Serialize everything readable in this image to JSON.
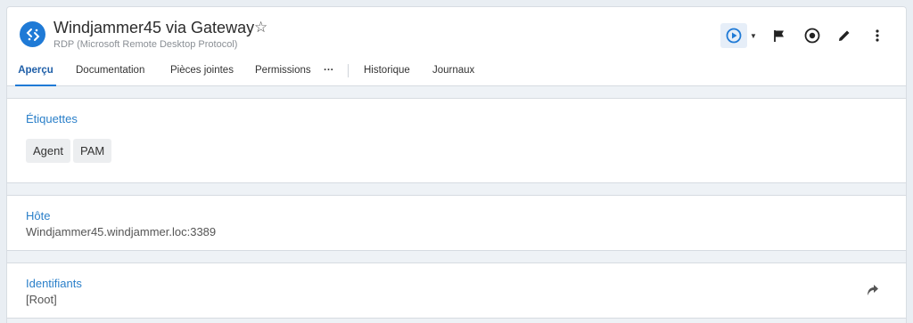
{
  "header": {
    "title": "Windjammer45 via Gateway",
    "subtitle": "RDP (Microsoft Remote Desktop Protocol)"
  },
  "actions": {
    "icons": [
      "play-icon",
      "caret-down-icon",
      "flag-icon",
      "download-circle-icon",
      "pencil-icon",
      "more-vert-icon"
    ]
  },
  "tabs": [
    {
      "label": "Aperçu",
      "active": true
    },
    {
      "label": "Documentation"
    },
    {
      "label": "Pièces jointes"
    },
    {
      "label": "Permissions"
    },
    {
      "label": "···"
    },
    {
      "label": "Historique"
    },
    {
      "label": "Journaux"
    }
  ],
  "sections": {
    "tags": {
      "title": "Étiquettes",
      "items": [
        "Agent",
        "PAM"
      ]
    },
    "host": {
      "title": "Hôte",
      "value": "Windjammer45.windjammer.loc:3389"
    },
    "credentials": {
      "title": "Identifiants",
      "value": "[Root]"
    }
  },
  "colors": {
    "accent": "#1f7ad6",
    "link": "#2a7fc9"
  }
}
